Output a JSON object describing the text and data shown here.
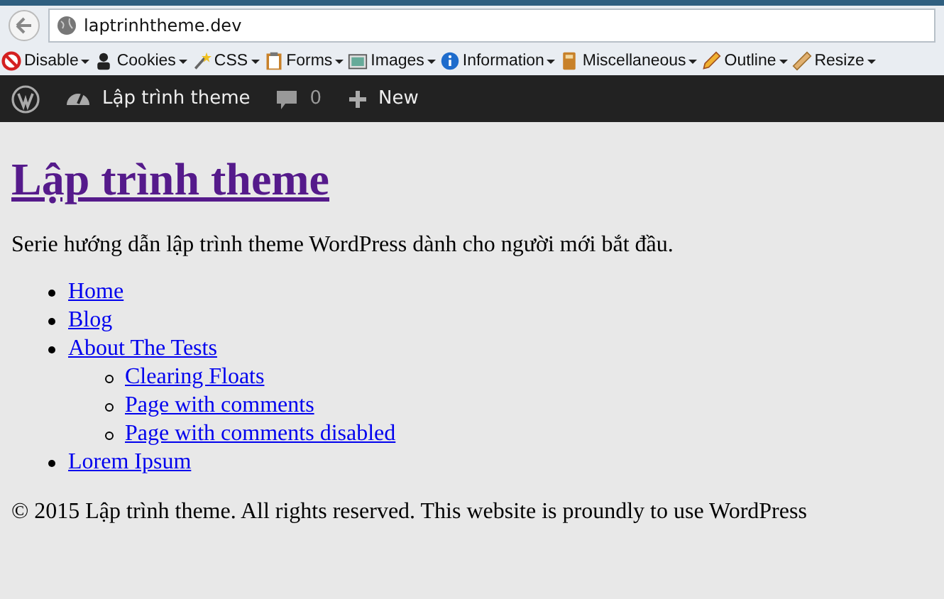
{
  "address_bar": {
    "url": "laptrinhtheme.dev"
  },
  "toolbar": [
    {
      "label": "Disable",
      "kind": "forbid"
    },
    {
      "label": "Cookies",
      "kind": "person"
    },
    {
      "label": "CSS",
      "kind": "wand"
    },
    {
      "label": "Forms",
      "kind": "clipboard"
    },
    {
      "label": "Images",
      "kind": "image"
    },
    {
      "label": "Information",
      "kind": "info"
    },
    {
      "label": "Miscellaneous",
      "kind": "book"
    },
    {
      "label": "Outline",
      "kind": "pencil"
    },
    {
      "label": "Resize",
      "kind": "ruler"
    }
  ],
  "admin_bar": {
    "site": "Lập trình theme",
    "comments": "0",
    "new": "New"
  },
  "page": {
    "title": "Lập trình theme",
    "description": "Serie hướng dẫn lập trình theme WordPress dành cho người mới bắt đầu.",
    "menu": [
      {
        "label": "Home"
      },
      {
        "label": "Blog"
      },
      {
        "label": "About The Tests",
        "children": [
          {
            "label": "Clearing Floats"
          },
          {
            "label": "Page with comments"
          },
          {
            "label": "Page with comments disabled"
          }
        ]
      },
      {
        "label": "Lorem Ipsum"
      }
    ],
    "footer": "© 2015 Lập trình theme. All rights reserved. This website is proundly to use WordPress"
  }
}
